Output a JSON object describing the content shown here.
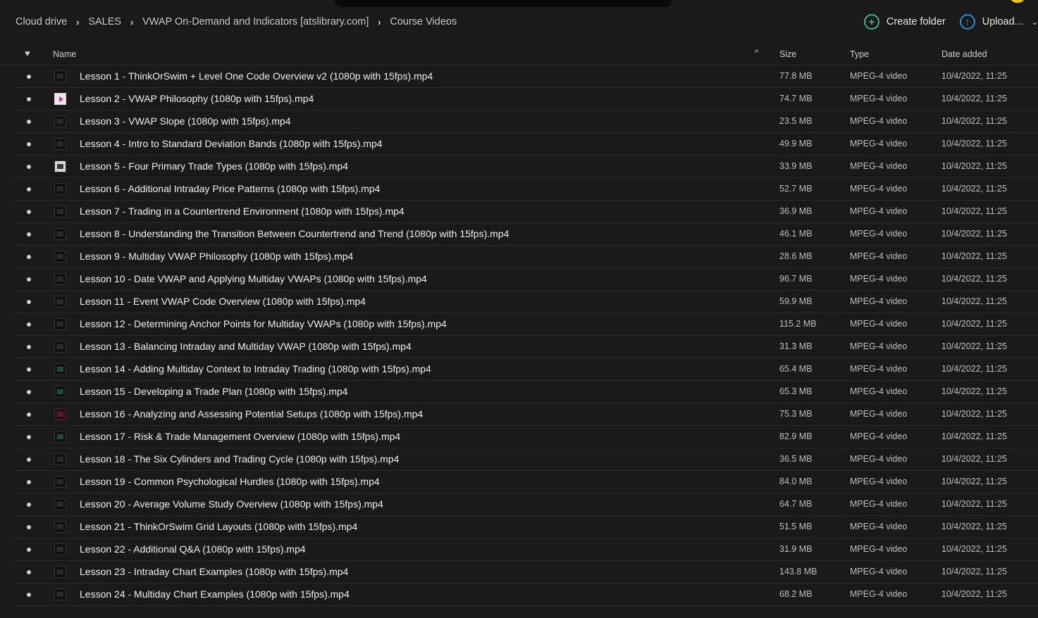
{
  "breadcrumb": [
    "Cloud drive",
    "SALES",
    "VWAP On-Demand and Indicators [atslibrary.com]",
    "Course Videos"
  ],
  "actions": {
    "create_folder": "Create folder",
    "upload": "Upload..."
  },
  "columns": {
    "name": "Name",
    "size": "Size",
    "type": "Type",
    "date": "Date added"
  },
  "files": [
    {
      "name": "Lesson 1 - ThinkOrSwim + Level One Code Overview v2 (1080p with 15fps).mp4",
      "size": "77.8 MB",
      "type": "MPEG-4 video",
      "date": "10/4/2022, 11:25",
      "thumb": "dark"
    },
    {
      "name": "Lesson 2 - VWAP Philosophy (1080p with 15fps).mp4",
      "size": "74.7 MB",
      "type": "MPEG-4 video",
      "date": "10/4/2022, 11:25",
      "thumb": "pink"
    },
    {
      "name": "Lesson 3 - VWAP Slope (1080p with 15fps).mp4",
      "size": "23.5 MB",
      "type": "MPEG-4 video",
      "date": "10/4/2022, 11:25",
      "thumb": "dark"
    },
    {
      "name": "Lesson 4 - Intro to Standard Deviation Bands (1080p with 15fps).mp4",
      "size": "49.9 MB",
      "type": "MPEG-4 video",
      "date": "10/4/2022, 11:25",
      "thumb": "dark"
    },
    {
      "name": "Lesson 5 - Four Primary Trade Types (1080p with 15fps).mp4",
      "size": "33.9 MB",
      "type": "MPEG-4 video",
      "date": "10/4/2022, 11:25",
      "thumb": "light"
    },
    {
      "name": "Lesson 6 - Additional Intraday Price Patterns (1080p with 15fps).mp4",
      "size": "52.7 MB",
      "type": "MPEG-4 video",
      "date": "10/4/2022, 11:25",
      "thumb": "dark"
    },
    {
      "name": "Lesson 7 - Trading in a Countertrend Environment (1080p with 15fps).mp4",
      "size": "36.9 MB",
      "type": "MPEG-4 video",
      "date": "10/4/2022, 11:25",
      "thumb": "dark"
    },
    {
      "name": "Lesson 8 - Understanding the Transition Between Countertrend and Trend (1080p with 15fps).mp4",
      "size": "46.1 MB",
      "type": "MPEG-4 video",
      "date": "10/4/2022, 11:25",
      "thumb": "dark"
    },
    {
      "name": "Lesson 9 - Multiday VWAP Philosophy (1080p with 15fps).mp4",
      "size": "28.6 MB",
      "type": "MPEG-4 video",
      "date": "10/4/2022, 11:25",
      "thumb": "dark"
    },
    {
      "name": "Lesson 10 - Date VWAP and Applying Multiday VWAPs (1080p with 15fps).mp4",
      "size": "96.7 MB",
      "type": "MPEG-4 video",
      "date": "10/4/2022, 11:25",
      "thumb": "dark"
    },
    {
      "name": "Lesson 11 - Event VWAP Code Overview (1080p with 15fps).mp4",
      "size": "59.9 MB",
      "type": "MPEG-4 video",
      "date": "10/4/2022, 11:25",
      "thumb": "dark"
    },
    {
      "name": "Lesson 12 - Determining Anchor Points for Multiday VWAPs (1080p with 15fps).mp4",
      "size": "115.2 MB",
      "type": "MPEG-4 video",
      "date": "10/4/2022, 11:25",
      "thumb": "dark"
    },
    {
      "name": "Lesson 13 - Balancing Intraday and Multiday VWAP (1080p with 15fps).mp4",
      "size": "31.3 MB",
      "type": "MPEG-4 video",
      "date": "10/4/2022, 11:25",
      "thumb": "dark"
    },
    {
      "name": "Lesson 14 - Adding Multiday Context to Intraday Trading (1080p with 15fps).mp4",
      "size": "65.4 MB",
      "type": "MPEG-4 video",
      "date": "10/4/2022, 11:25",
      "thumb": "green"
    },
    {
      "name": "Lesson 15 - Developing a Trade Plan (1080p with 15fps).mp4",
      "size": "65.3 MB",
      "type": "MPEG-4 video",
      "date": "10/4/2022, 11:25",
      "thumb": "green"
    },
    {
      "name": "Lesson 16 - Analyzing and Assessing Potential Setups (1080p with 15fps).mp4",
      "size": "75.3 MB",
      "type": "MPEG-4 video",
      "date": "10/4/2022, 11:25",
      "thumb": "red"
    },
    {
      "name": "Lesson 17 - Risk & Trade Management Overview (1080p with 15fps).mp4",
      "size": "82.9 MB",
      "type": "MPEG-4 video",
      "date": "10/4/2022, 11:25",
      "thumb": "green"
    },
    {
      "name": "Lesson 18 - The Six Cylinders and Trading Cycle (1080p with 15fps).mp4",
      "size": "36.5 MB",
      "type": "MPEG-4 video",
      "date": "10/4/2022, 11:25",
      "thumb": "dark"
    },
    {
      "name": "Lesson 19 - Common Psychological Hurdles (1080p with 15fps).mp4",
      "size": "84.0 MB",
      "type": "MPEG-4 video",
      "date": "10/4/2022, 11:25",
      "thumb": "dark"
    },
    {
      "name": "Lesson 20 - Average Volume Study Overview (1080p with 15fps).mp4",
      "size": "64.7 MB",
      "type": "MPEG-4 video",
      "date": "10/4/2022, 11:25",
      "thumb": "dark"
    },
    {
      "name": "Lesson 21 - ThinkOrSwim Grid Layouts (1080p with 15fps).mp4",
      "size": "51.5 MB",
      "type": "MPEG-4 video",
      "date": "10/4/2022, 11:25",
      "thumb": "dark"
    },
    {
      "name": "Lesson 22 - Additional Q&A (1080p with 15fps).mp4",
      "size": "31.9 MB",
      "type": "MPEG-4 video",
      "date": "10/4/2022, 11:25",
      "thumb": "dark"
    },
    {
      "name": "Lesson 23 - Intraday Chart Examples (1080p with 15fps).mp4",
      "size": "143.8 MB",
      "type": "MPEG-4 video",
      "date": "10/4/2022, 11:25",
      "thumb": "dark"
    },
    {
      "name": "Lesson 24 - Multiday Chart Examples (1080p with 15fps).mp4",
      "size": "68.2 MB",
      "type": "MPEG-4 video",
      "date": "10/4/2022, 11:25",
      "thumb": "dark"
    }
  ]
}
